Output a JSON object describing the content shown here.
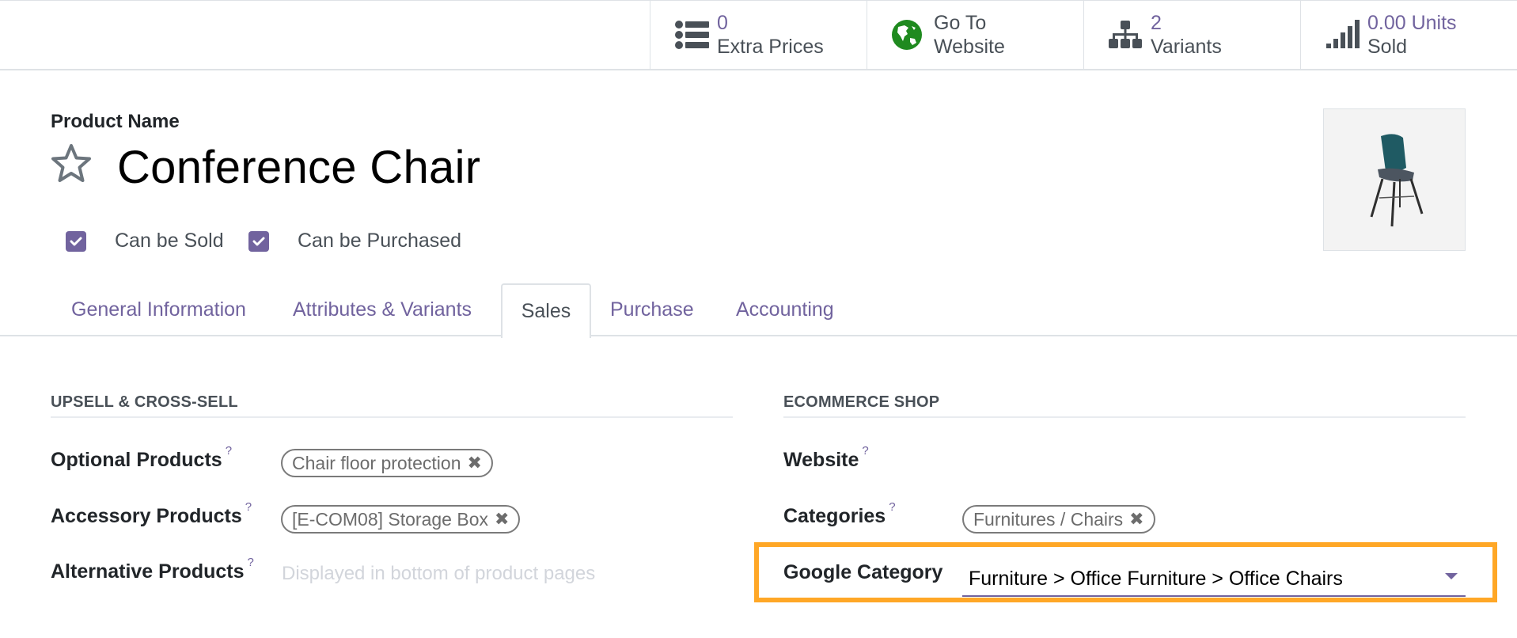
{
  "smart_buttons": [
    {
      "icon": "list-icon",
      "value": "0",
      "label": "Extra Prices"
    },
    {
      "icon": "globe-icon",
      "value": "Go To",
      "label": "Website"
    },
    {
      "icon": "sitemap-icon",
      "value": "2",
      "label": "Variants"
    },
    {
      "icon": "signal-bars-icon",
      "value": "0.00 Units",
      "label": "Sold"
    }
  ],
  "product": {
    "name_label": "Product Name",
    "name": "Conference Chair",
    "favorite": false,
    "can_be_sold_label": "Can be Sold",
    "can_be_sold": true,
    "can_be_purchased_label": "Can be Purchased",
    "can_be_purchased": true,
    "image_alt": "chair-image"
  },
  "tabs": [
    {
      "label": "General Information",
      "active": false
    },
    {
      "label": "Attributes & Variants",
      "active": false
    },
    {
      "label": "Sales",
      "active": true
    },
    {
      "label": "Purchase",
      "active": false
    },
    {
      "label": "Accounting",
      "active": false
    }
  ],
  "upsell": {
    "title": "UPSELL & CROSS-SELL",
    "help_glyph": "?",
    "optional_label": "Optional Products",
    "optional_tags": [
      "Chair floor protection"
    ],
    "accessory_label": "Accessory Products",
    "accessory_tags": [
      "[E-COM08] Storage Box"
    ],
    "alternative_label": "Alternative Products",
    "alternative_placeholder": "Displayed in bottom of product pages",
    "remove_glyph": "✖"
  },
  "ecommerce": {
    "title": "ECOMMERCE SHOP",
    "website_label": "Website",
    "website_value": "",
    "categories_label": "Categories",
    "categories_tags": [
      "Furnitures / Chairs"
    ],
    "google_category_label": "Google Category",
    "google_category_value": "Furniture > Office Furniture > Office Chairs"
  },
  "colors": {
    "accent": "#71639e",
    "highlight": "#ffa726",
    "globe": "#1f8a1f"
  }
}
